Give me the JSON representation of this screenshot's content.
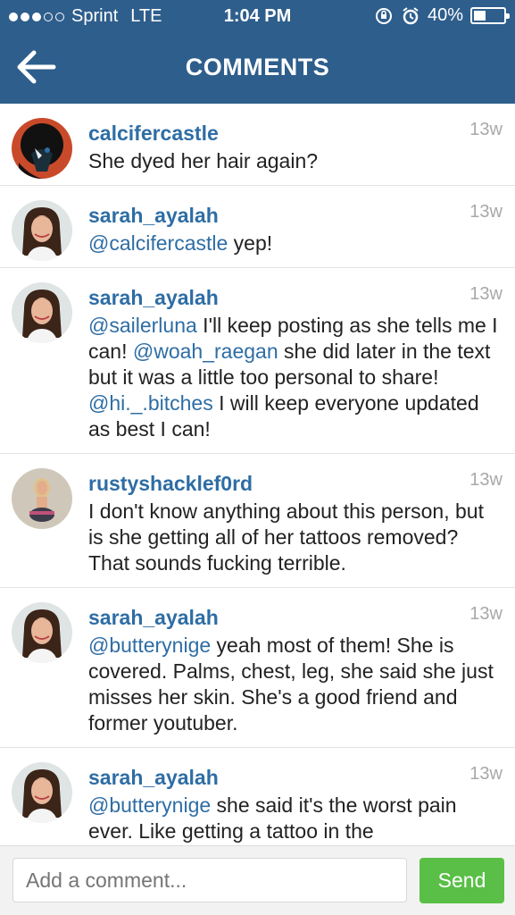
{
  "status_bar": {
    "carrier": "Sprint",
    "network": "LTE",
    "time": "1:04 PM",
    "battery_text": "40%",
    "battery_level": 0.4,
    "signal_bars_filled": 3,
    "signal_bars_total": 5
  },
  "header": {
    "title": "COMMENTS",
    "background_color": "#2e5e8c"
  },
  "comments": [
    {
      "username": "calcifercastle",
      "time": "13w",
      "parts": [
        {
          "text": "She dyed her hair again?",
          "mention": false
        }
      ]
    },
    {
      "username": "sarah_ayalah",
      "time": "13w",
      "parts": [
        {
          "text": "@calcifercastle",
          "mention": true
        },
        {
          "text": " yep!",
          "mention": false
        }
      ]
    },
    {
      "username": "sarah_ayalah",
      "time": "13w",
      "parts": [
        {
          "text": "@sailerluna",
          "mention": true
        },
        {
          "text": " I'll keep posting as she tells me I can! ",
          "mention": false
        },
        {
          "text": "@woah_raegan",
          "mention": true
        },
        {
          "text": " she did later in the text but it was a little too personal to share! ",
          "mention": false
        },
        {
          "text": "@hi._.bitches",
          "mention": true
        },
        {
          "text": " I will keep everyone updated as best I can!",
          "mention": false
        }
      ]
    },
    {
      "username": "rustyshacklef0rd",
      "time": "13w",
      "parts": [
        {
          "text": "I don't know anything about this person, but is she getting all of her tattoos removed? That sounds fucking terrible.",
          "mention": false
        }
      ]
    },
    {
      "username": "sarah_ayalah",
      "time": "13w",
      "parts": [
        {
          "text": "@butterynige",
          "mention": true
        },
        {
          "text": " yeah most of them! She is covered. Palms, chest, leg, she said she just misses her skin.  She's a good friend and former youtuber.",
          "mention": false
        }
      ]
    },
    {
      "username": "sarah_ayalah",
      "time": "13w",
      "parts": [
        {
          "text": "@butterynige",
          "mention": true
        },
        {
          "text": " she said it's the worst pain ever. Like getting a tattoo in the",
          "mention": false
        }
      ]
    }
  ],
  "composer": {
    "placeholder": "Add a comment...",
    "send_label": "Send",
    "send_color": "#59bf46"
  }
}
